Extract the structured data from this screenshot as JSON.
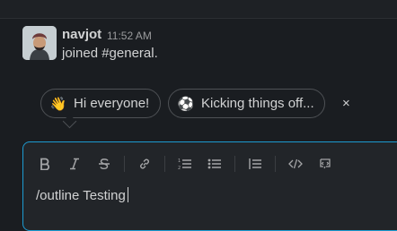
{
  "message": {
    "author": "navjot",
    "time": "11:52 AM",
    "text": "joined #general."
  },
  "suggestions": {
    "items": [
      {
        "emoji_icon": "waving-hand-icon",
        "emoji": "👋",
        "label": "Hi everyone!"
      },
      {
        "emoji_icon": "soccer-ball-icon",
        "emoji": "⚽",
        "label": "Kicking things off..."
      }
    ],
    "close_label": "×"
  },
  "composer": {
    "toolbar": [
      "bold-icon",
      "italic-icon",
      "strikethrough-icon",
      "link-icon",
      "ordered-list-icon",
      "bulleted-list-icon",
      "blockquote-icon",
      "code-icon",
      "code-block-icon"
    ],
    "text": "/outline Testing"
  },
  "colors": {
    "background": "#1a1d21",
    "focus_border": "#1d9bd1",
    "text": "#d1d2d3",
    "muted": "#9a9b9d"
  }
}
